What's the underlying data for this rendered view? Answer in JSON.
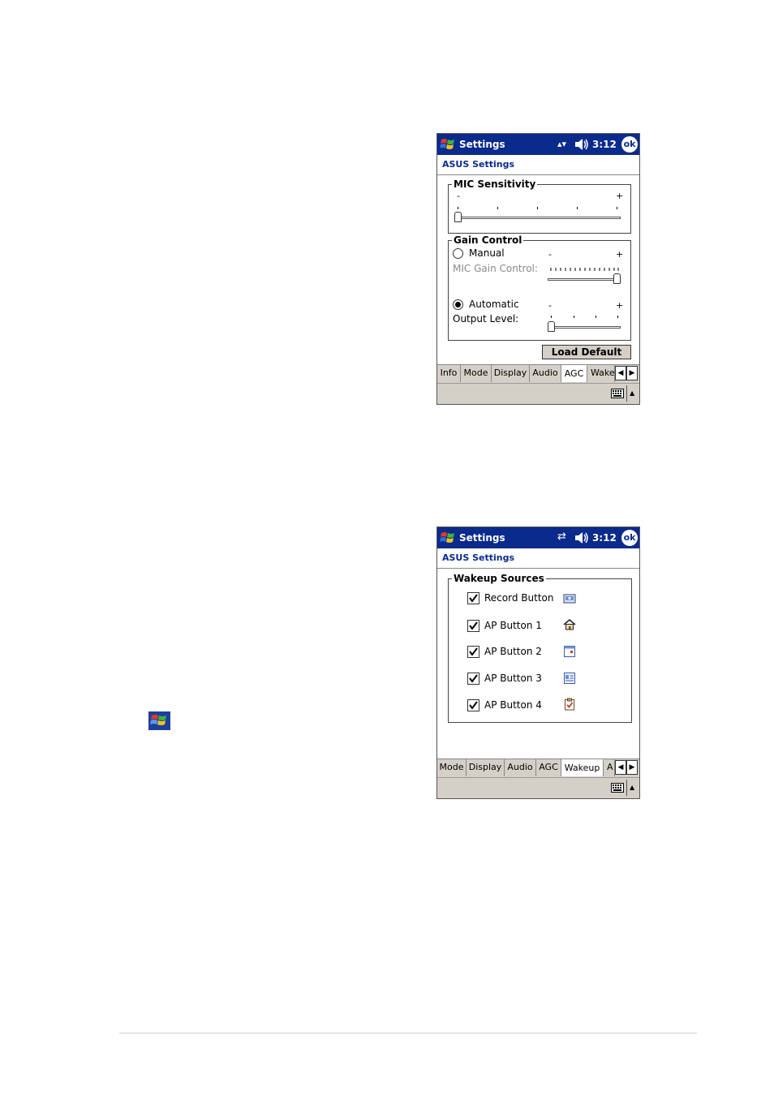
{
  "screen1": {
    "title": "Settings",
    "status_connectivity": "▴▾",
    "time": "3:12",
    "ok_label": "ok",
    "subheader": "ASUS Settings",
    "mic": {
      "label": "MIC Sensitivity",
      "minus": "-",
      "plus": "+",
      "level": 0
    },
    "gain": {
      "label": "Gain Control",
      "manual_label": "Manual",
      "manual_selected": false,
      "mic_gain_label": "MIC Gain Control:",
      "manual_minus": "-",
      "manual_plus": "+",
      "manual_level": 1.0,
      "automatic_label": "Automatic",
      "automatic_selected": true,
      "output_label": "Output Level:",
      "auto_minus": "-",
      "auto_plus": "+",
      "auto_level": 0
    },
    "load_default": "Load Default",
    "tabs": [
      "Info",
      "Mode",
      "Display",
      "Audio",
      "AGC",
      "Wake"
    ],
    "active_tab": "AGC"
  },
  "screen2": {
    "title": "Settings",
    "status_connectivity": "⇄",
    "time": "3:12",
    "ok_label": "ok",
    "subheader": "ASUS Settings",
    "wakeup": {
      "label": "Wakeup Sources",
      "items": [
        {
          "label": "Record Button",
          "checked": true,
          "icon": "record-icon"
        },
        {
          "label": "AP Button 1",
          "checked": true,
          "icon": "home-icon"
        },
        {
          "label": "AP Button 2",
          "checked": true,
          "icon": "calendar-icon"
        },
        {
          "label": "AP Button 3",
          "checked": true,
          "icon": "contacts-icon"
        },
        {
          "label": "AP Button 4",
          "checked": true,
          "icon": "tasks-icon"
        }
      ]
    },
    "tabs": [
      "Mode",
      "Display",
      "Audio",
      "AGC",
      "Wakeup",
      "A"
    ],
    "active_tab": "Wakeup"
  },
  "colors": {
    "titlebar": "#0a2a8c",
    "accent_text": "#0a2a8c",
    "chrome": "#d4d0c8"
  }
}
